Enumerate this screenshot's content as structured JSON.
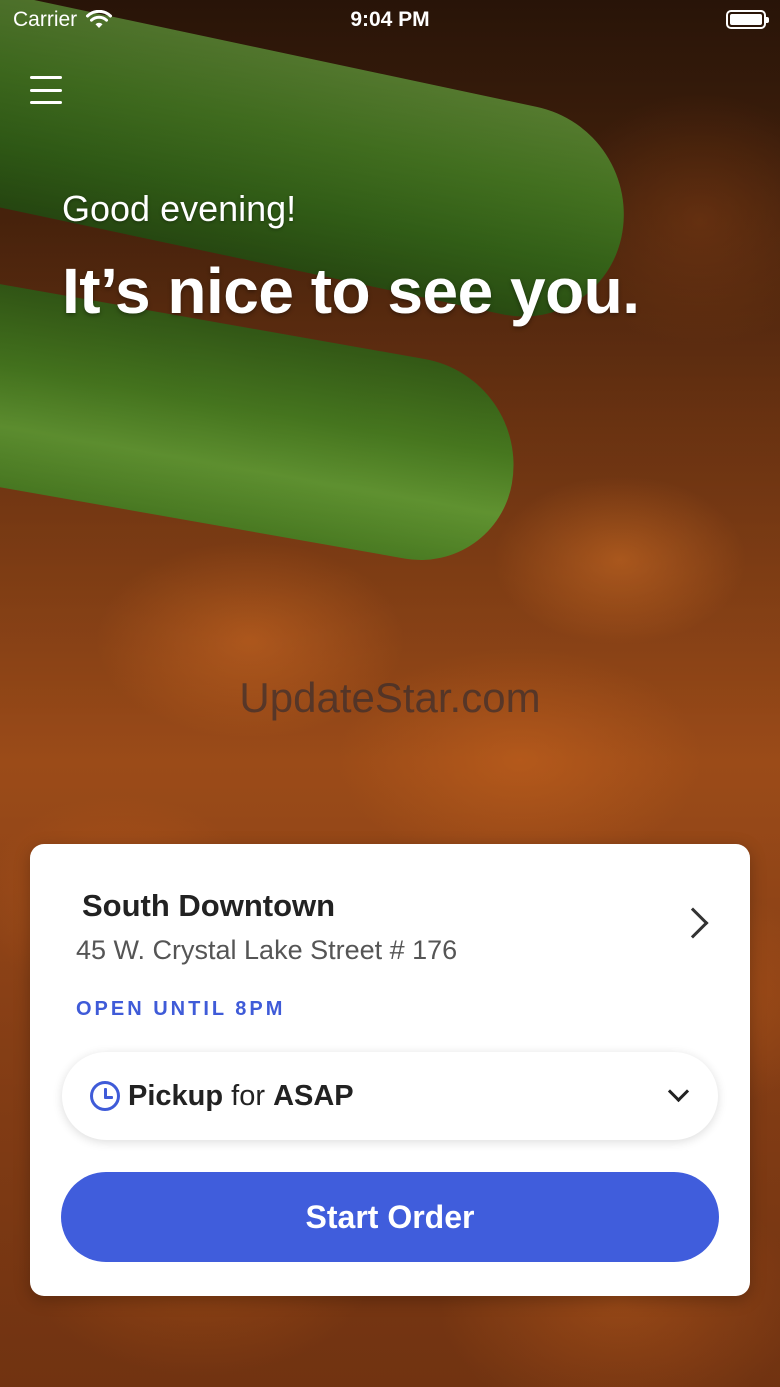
{
  "status_bar": {
    "carrier": "Carrier",
    "time": "9:04 PM",
    "wifi_icon": "wifi-icon",
    "battery_icon": "battery-icon"
  },
  "menu": {
    "icon": "hamburger-menu-icon"
  },
  "greeting": {
    "subtitle": "Good evening!",
    "title": "It’s nice to see you."
  },
  "watermark": "UpdateStar.com",
  "location": {
    "name": "South Downtown",
    "address": "45 W. Crystal Lake Street # 176",
    "hours": "OPEN UNTIL 8PM",
    "chevron_icon": "chevron-right-icon"
  },
  "order_mode": {
    "icon": "clock-icon",
    "mode": "Pickup",
    "connector": "for",
    "time": "ASAP",
    "dropdown_icon": "chevron-down-icon"
  },
  "actions": {
    "start_order": "Start Order"
  },
  "colors": {
    "accent": "#405DDC",
    "hours_text": "#3F5BD8",
    "card_bg": "#FFFFFF"
  }
}
